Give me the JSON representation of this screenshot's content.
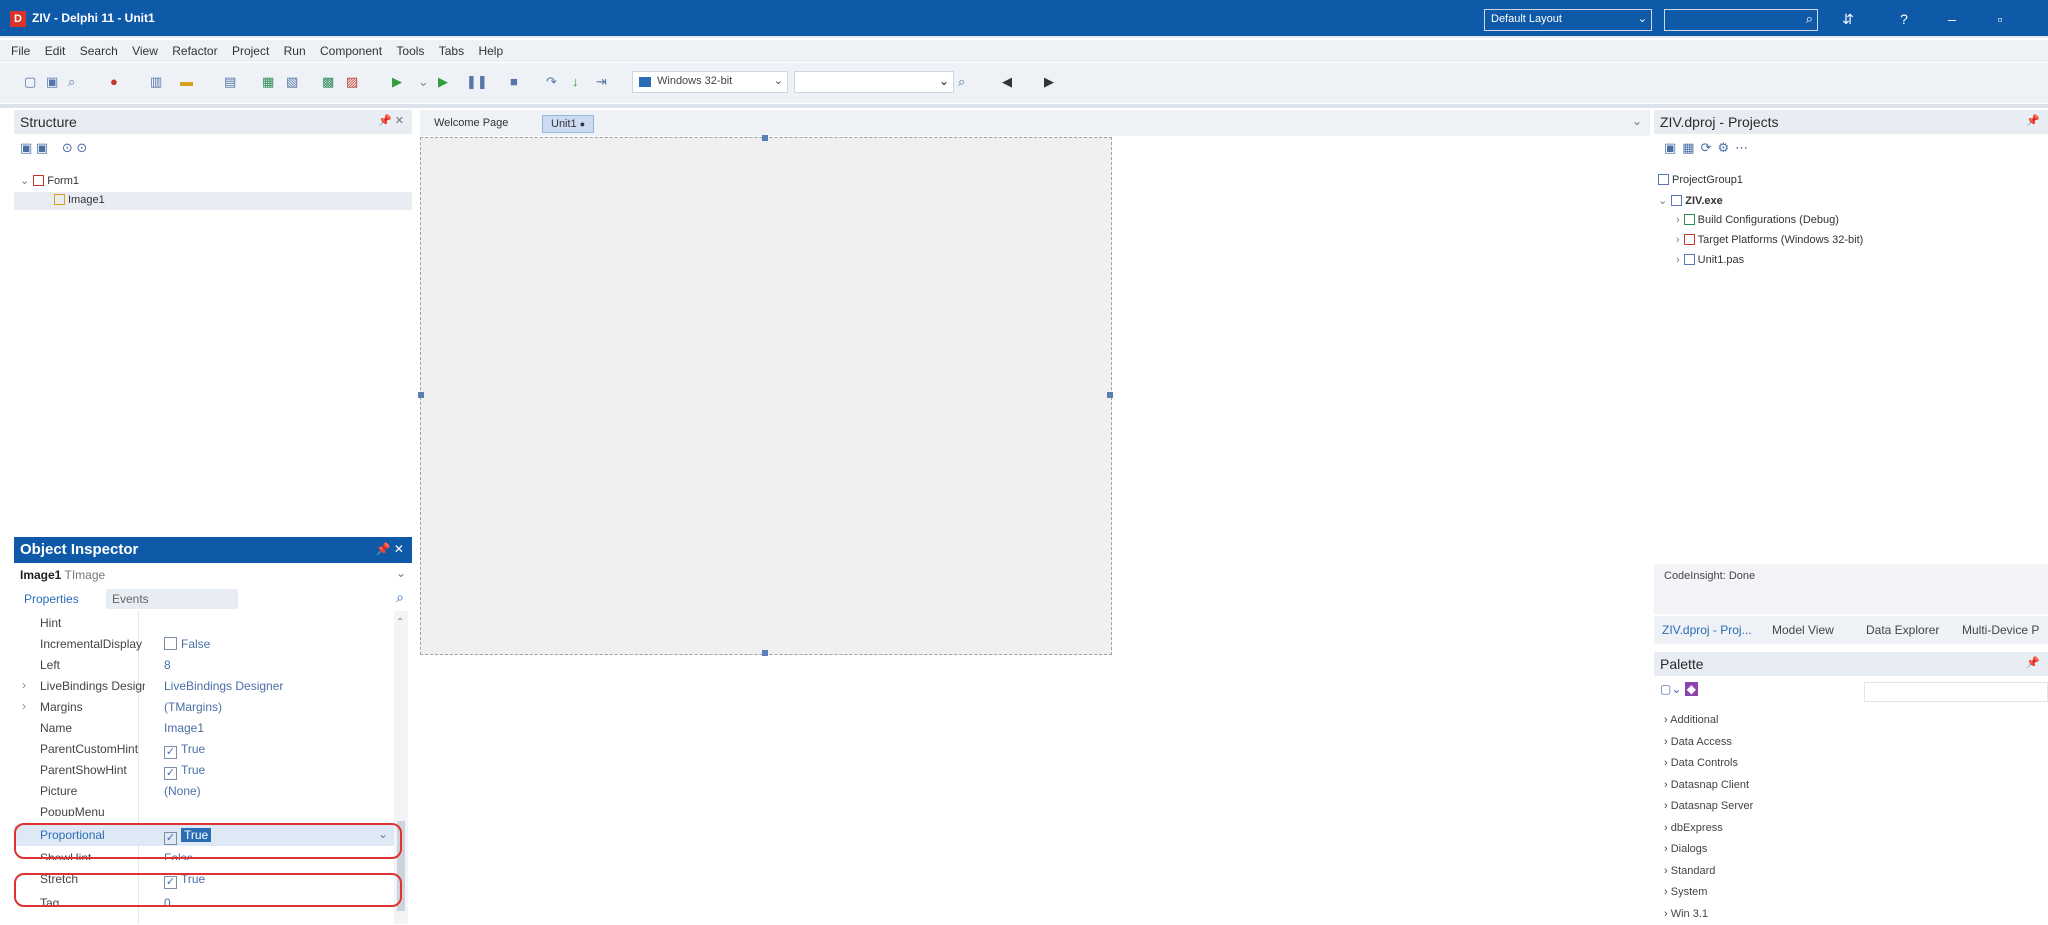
{
  "window": {
    "title": "ZIV - Delphi 11 - Unit1",
    "layout": "Default Layout"
  },
  "menu": [
    "File",
    "Edit",
    "Search",
    "View",
    "Refactor",
    "Project",
    "Run",
    "Component",
    "Tools",
    "Tabs",
    "Help"
  ],
  "toolbar": {
    "platform": "Windows 32-bit"
  },
  "structure": {
    "title": "Structure",
    "items": [
      "Form1",
      "Image1"
    ]
  },
  "editor": {
    "tabs": [
      "Welcome Page",
      "Unit1"
    ]
  },
  "inspector": {
    "title": "Object Inspector",
    "object": "Image1",
    "object_type": "TImage",
    "tabs": [
      "Properties",
      "Events"
    ],
    "properties": [
      {
        "name": "Hint",
        "value": ""
      },
      {
        "name": "IncrementalDisplay",
        "value": "False"
      },
      {
        "name": "Left",
        "value": "8"
      },
      {
        "name": "LiveBindings Designer",
        "value": "LiveBindings Designer"
      },
      {
        "name": "Margins",
        "value": "(TMargins)"
      },
      {
        "name": "Name",
        "value": "Image1"
      },
      {
        "name": "ParentCustomHint",
        "value": "True"
      },
      {
        "name": "ParentShowHint",
        "value": "True"
      },
      {
        "name": "Picture",
        "value": "(None)"
      },
      {
        "name": "PopupMenu",
        "value": ""
      },
      {
        "name": "Proportional",
        "value": "True"
      },
      {
        "name": "ShowHint",
        "value": "False"
      },
      {
        "name": "Stretch",
        "value": "True"
      },
      {
        "name": "Tag",
        "value": "0"
      }
    ]
  },
  "projects": {
    "title": "ZIV.dproj - Projects",
    "group": "ProjectGroup1",
    "project": "ZIV.exe",
    "nodes": [
      "Build Configurations (Debug)",
      "Target Platforms (Windows 32-bit)",
      "Unit1.pas"
    ],
    "status": "CodeInsight: Done",
    "tabs": [
      "ZIV.dproj - Proj...",
      "Model View",
      "Data Explorer",
      "Multi-Device P"
    ]
  },
  "palette": {
    "title": "Palette",
    "categories": [
      "Additional",
      "Data Access",
      "Data Controls",
      "Datasnap Client",
      "Datasnap Server",
      "dbExpress",
      "Dialogs",
      "Standard",
      "System",
      "Win 3.1"
    ]
  }
}
